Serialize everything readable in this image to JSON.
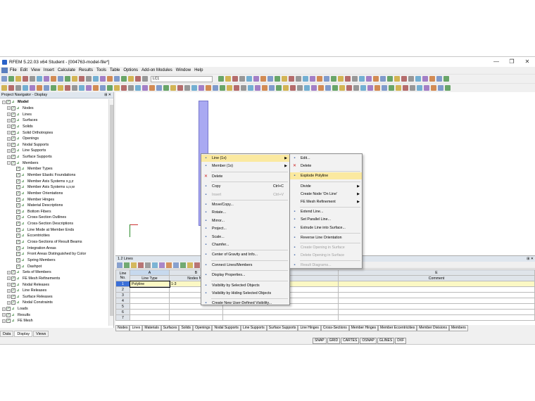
{
  "window": {
    "title": "RFEM 5.22.03 x64 Student - [004763-model-file*]",
    "controls": [
      "—",
      "❐",
      "✕"
    ]
  },
  "menu": [
    "File",
    "Edit",
    "View",
    "Insert",
    "Calculate",
    "Results",
    "Tools",
    "Table",
    "Options",
    "Add-on Modules",
    "Window",
    "Help"
  ],
  "toolbar": {
    "load_case": "LC1"
  },
  "navigator": {
    "title": "Project Navigator - Display",
    "pin": "⊞ ✕",
    "tree": [
      {
        "label": "Model",
        "depth": 0,
        "bold": true
      },
      {
        "label": "Nodes",
        "depth": 1
      },
      {
        "label": "Lines",
        "depth": 1
      },
      {
        "label": "Surfaces",
        "depth": 1
      },
      {
        "label": "Solids",
        "depth": 1
      },
      {
        "label": "Solid Orthotropies",
        "depth": 1
      },
      {
        "label": "Openings",
        "depth": 1
      },
      {
        "label": "Nodal Supports",
        "depth": 1
      },
      {
        "label": "Line Supports",
        "depth": 1
      },
      {
        "label": "Surface Supports",
        "depth": 1
      },
      {
        "label": "Members",
        "depth": 1
      },
      {
        "label": "Member Types",
        "depth": 2
      },
      {
        "label": "Member Elastic Foundations",
        "depth": 2
      },
      {
        "label": "Member Axis Systems x,y,z",
        "depth": 2
      },
      {
        "label": "Member Axis Systems u,v,w",
        "depth": 2
      },
      {
        "label": "Member Orientations",
        "depth": 2
      },
      {
        "label": "Member Hinges",
        "depth": 2
      },
      {
        "label": "Material Descriptions",
        "depth": 2
      },
      {
        "label": "Bottom Fibers",
        "depth": 2
      },
      {
        "label": "Cross-Section Outlines",
        "depth": 2
      },
      {
        "label": "Cross-Section Descriptions",
        "depth": 2
      },
      {
        "label": "Line Mode at Member Ends",
        "depth": 2
      },
      {
        "label": "Eccentricities",
        "depth": 2
      },
      {
        "label": "Cross-Sections of Result Beams",
        "depth": 2
      },
      {
        "label": "Integration Areas",
        "depth": 2
      },
      {
        "label": "Front Areas Distinguished by Color",
        "depth": 2
      },
      {
        "label": "Spring Members",
        "depth": 2
      },
      {
        "label": "Dashpot",
        "depth": 2
      },
      {
        "label": "Sets of Members",
        "depth": 1
      },
      {
        "label": "FE Mesh Refinements",
        "depth": 1
      },
      {
        "label": "Nodal Releases",
        "depth": 1
      },
      {
        "label": "Line Releases",
        "depth": 1
      },
      {
        "label": "Surface Releases",
        "depth": 1
      },
      {
        "label": "Nodal Constraints",
        "depth": 1
      },
      {
        "label": "Loads",
        "depth": 0
      },
      {
        "label": "Results",
        "depth": 0
      },
      {
        "label": "FE Mesh",
        "depth": 0
      }
    ],
    "tabs": [
      "Data",
      "Display",
      "Views"
    ]
  },
  "table": {
    "title": "1.2 Lines",
    "columns": [
      {
        "letter": "",
        "name": "Line\nNo."
      },
      {
        "letter": "A",
        "name": "Line Type"
      },
      {
        "letter": "B",
        "name": "Nodes No."
      },
      {
        "letter": "",
        "name": ""
      },
      {
        "letter": "E",
        "name": "Comment"
      }
    ],
    "rows": [
      {
        "no": "1",
        "type": "Polyline",
        "nodes": "1-3"
      },
      {
        "no": "2",
        "type": "",
        "nodes": ""
      },
      {
        "no": "3",
        "type": "",
        "nodes": ""
      },
      {
        "no": "4",
        "type": "",
        "nodes": ""
      },
      {
        "no": "5",
        "type": "",
        "nodes": ""
      },
      {
        "no": "6",
        "type": "",
        "nodes": ""
      },
      {
        "no": "7",
        "type": "",
        "nodes": ""
      }
    ],
    "sheets": [
      "Nodes",
      "Lines",
      "Materials",
      "Surfaces",
      "Solids",
      "Openings",
      "Nodal Supports",
      "Line Supports",
      "Surface Supports",
      "Line Hinges",
      "Cross-Sections",
      "Member Hinges",
      "Member Eccentricities",
      "Member Divisions",
      "Members"
    ],
    "active_sheet": "Lines"
  },
  "status": [
    "SNAP",
    "GRID",
    "CARTES",
    "OSNAP",
    "GLINES",
    "DXF"
  ],
  "context_menu": {
    "items": [
      {
        "label": "Line (1x)",
        "icon": "line-icon",
        "arrow": true,
        "highlight": true
      },
      {
        "label": "Member (1x)",
        "icon": "member-icon",
        "arrow": true
      },
      {
        "label": "Delete",
        "icon": "delete-icon"
      },
      {
        "label": "Copy",
        "icon": "copy-icon",
        "shortcut": "Ctrl+C"
      },
      {
        "label": "Insert",
        "icon": "insert-icon",
        "shortcut": "Ctrl+V",
        "disabled": true
      },
      {
        "label": "Move/Copy...",
        "icon": "move-icon"
      },
      {
        "label": "Rotate...",
        "icon": "rotate-icon"
      },
      {
        "label": "Mirror...",
        "icon": "mirror-icon"
      },
      {
        "label": "Project...",
        "icon": "project-icon"
      },
      {
        "label": "Scale...",
        "icon": "scale-icon"
      },
      {
        "label": "Chamfer...",
        "icon": "chamfer-icon"
      },
      {
        "label": "Center of Gravity and Info...",
        "icon": "gravity-icon"
      },
      {
        "label": "Connect Lines/Members",
        "icon": "connect-icon"
      },
      {
        "label": "Display Properties...",
        "icon": "display-icon"
      },
      {
        "label": "Visibility by Selected Objects",
        "icon": "visibility-icon"
      },
      {
        "label": "Visibility by Hiding Selected Objects",
        "icon": "hide-icon"
      },
      {
        "label": "Create New User-Defined Visibility...",
        "icon": "visibility-new-icon"
      }
    ]
  },
  "submenu": {
    "items": [
      {
        "label": "Edit...",
        "icon": "edit-icon"
      },
      {
        "label": "Delete",
        "icon": "delete-icon"
      },
      {
        "label": "Explode Polyline",
        "icon": "explode-icon",
        "highlight": true
      },
      {
        "label": "Divide",
        "icon": "",
        "arrow": true
      },
      {
        "label": "Create Node 'On Line'",
        "icon": "",
        "arrow": true
      },
      {
        "label": "FE Mesh Refinement",
        "icon": "",
        "arrow": true
      },
      {
        "label": "Extend Line...",
        "icon": "extend-icon"
      },
      {
        "label": "Set Parallel Line...",
        "icon": "parallel-icon"
      },
      {
        "label": "Extrude Line into Surface...",
        "icon": "extrude-icon"
      },
      {
        "label": "Reverse Line Orientation",
        "icon": "reverse-icon"
      },
      {
        "label": "Create Opening in Surface",
        "icon": "opening-icon",
        "disabled": true
      },
      {
        "label": "Delete Opening in Surface",
        "icon": "opening-delete-icon",
        "disabled": true
      },
      {
        "label": "Result Diagrams...",
        "icon": "diagram-icon",
        "disabled": true
      }
    ]
  }
}
